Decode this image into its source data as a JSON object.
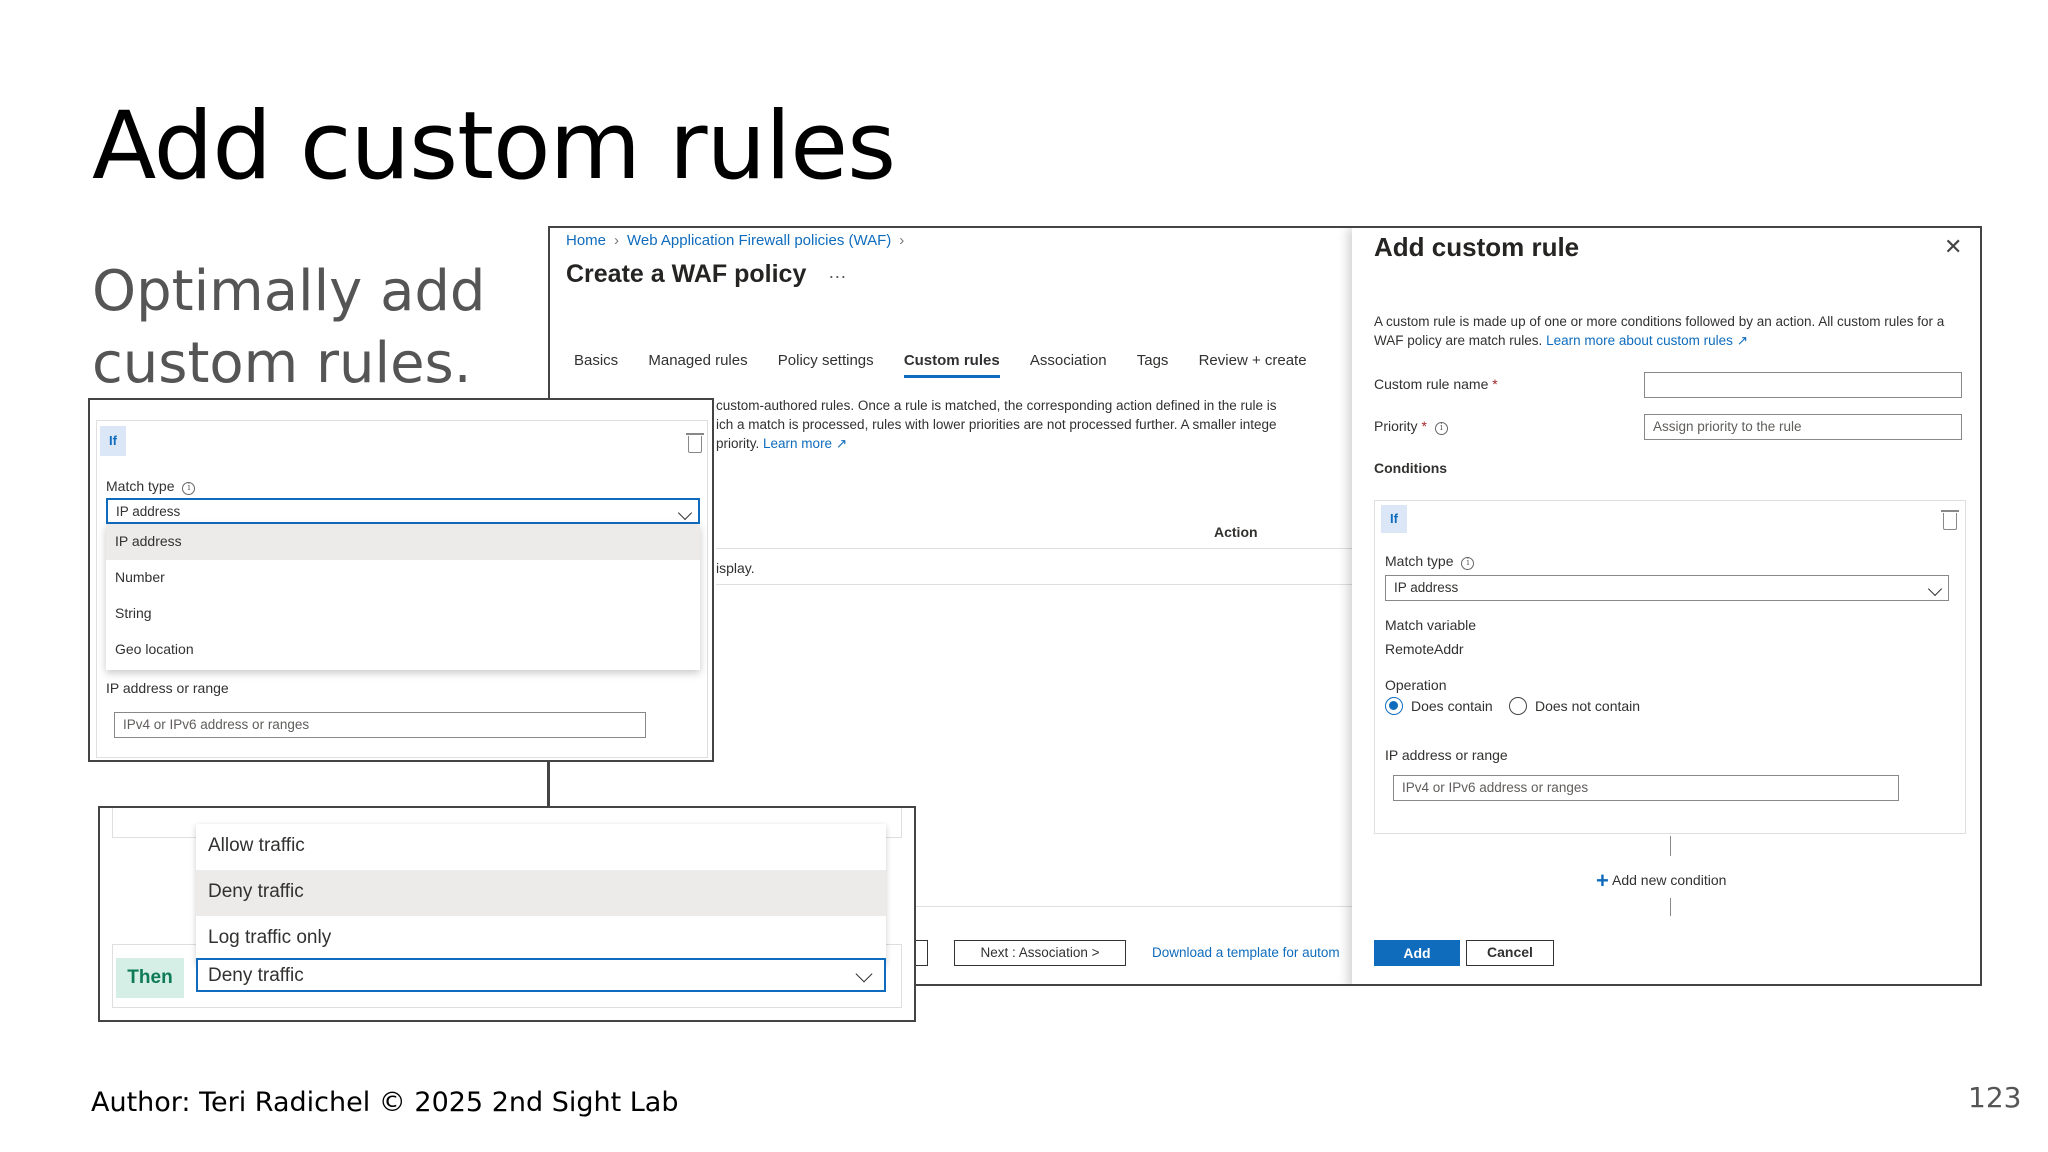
{
  "slide": {
    "title": "Add custom rules",
    "subtitle": "Optimally add custom rules.",
    "author": "Author: Teri Radichel © 2025 2nd Sight Lab",
    "page_number": "123"
  },
  "main": {
    "breadcrumb": [
      "Home",
      "Web Application Firewall policies (WAF)"
    ],
    "page_title": "Create a WAF policy",
    "more": "···",
    "tabs": [
      {
        "label": "Basics",
        "active": false
      },
      {
        "label": "Managed rules",
        "active": false
      },
      {
        "label": "Policy settings",
        "active": false
      },
      {
        "label": "Custom rules",
        "active": true
      },
      {
        "label": "Association",
        "active": false
      },
      {
        "label": "Tags",
        "active": false
      },
      {
        "label": "Review + create",
        "active": false
      }
    ],
    "desc_line1": "custom-authored rules. Once a rule is matched, the corresponding action defined in the rule is applie",
    "desc_line2": "ich a match is processed, rules with lower priorities are not processed further. A smaller integer value f",
    "desc_line3": "priority.",
    "learn_more": "Learn more",
    "col_action": "Action",
    "row_text": "isplay.",
    "next_button": "Next : Association >",
    "download_link": "Download a template for autom"
  },
  "panel": {
    "title": "Add custom rule",
    "close": "✕",
    "description": "A custom rule is made up of one or more conditions followed by an action. All custom rules for a WAF policy are match rules.",
    "learn_more": "Learn more about custom rules",
    "rule_name_label": "Custom rule name",
    "rule_name_value": "",
    "priority_label": "Priority",
    "priority_placeholder": "Assign priority to the rule",
    "conditions_label": "Conditions",
    "if_label": "If",
    "match_type_label": "Match type",
    "match_type_value": "IP address",
    "match_variable_label": "Match variable",
    "match_variable_value": "RemoteAddr",
    "operation_label": "Operation",
    "op_contains": "Does contain",
    "op_not_contains": "Does not contain",
    "ip_label": "IP address or range",
    "ip_placeholder": "IPv4 or IPv6 address or ranges",
    "add_condition": "Add new condition",
    "add_button": "Add",
    "cancel_button": "Cancel"
  },
  "inset1": {
    "if_label": "If",
    "match_type_label": "Match type",
    "match_type_value": "IP address",
    "options": [
      "IP address",
      "Number",
      "String",
      "Geo location"
    ],
    "selected_index": 0,
    "ip_label": "IP address or range",
    "ip_placeholder": "IPv4 or IPv6 address or ranges"
  },
  "inset2": {
    "options": [
      "Allow traffic",
      "Deny traffic",
      "Log traffic only"
    ],
    "selected_index": 1,
    "then_label": "Then",
    "then_value": "Deny traffic"
  },
  "colors": {
    "accent": "#0f6cbd",
    "then_badge_bg": "#d6efe6",
    "if_badge_bg": "#dbe6f7"
  }
}
